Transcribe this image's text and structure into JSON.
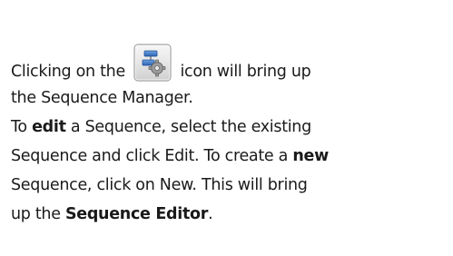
{
  "paragraph": {
    "line1_before_icon": "Clicking on the",
    "line1_after_icon": "icon will bring up",
    "icon": "sequence-manager-icon",
    "line2": "the Sequence Manager.",
    "line3_prefix": "To ",
    "line3_bold": "edit",
    "line3_suffix": " a Sequence, select the existing",
    "line4_prefix": "Sequence and click Edit. To create a ",
    "line4_bold": "new",
    "line5": "Sequence, click on New. This will bring",
    "line6_prefix": "up the ",
    "line6_bold": "Sequence Editor",
    "line6_suffix": "."
  }
}
